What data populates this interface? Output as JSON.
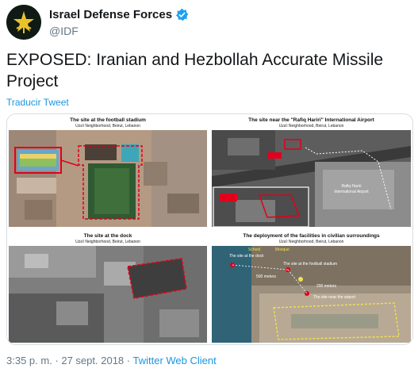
{
  "account": {
    "display_name": "Israel Defense Forces",
    "handle": "@IDF",
    "avatar_icon": "idf-emblem-icon",
    "verified_icon": "verified-badge-icon"
  },
  "tweet": {
    "text": "EXPOSED: Iranian and Hezbollah Accurate Missile Project",
    "translate_label": "Traducir Tweet",
    "timestamp": "3:35 p. m. · 27 sept. 2018",
    "separator": " · ",
    "source": "Twitter Web Client"
  },
  "media": {
    "panels": [
      {
        "title": "The site at the football stadium",
        "subtitle": "Uza'i Neighborhood, Beirut, Lebanon"
      },
      {
        "title": "The site near the \"Rafiq Hariri\" International Airport",
        "subtitle": "Uza'i Neighborhood, Beirut, Lebanon",
        "labels": [
          "Rafiq Hariri International Airport",
          "The site"
        ]
      },
      {
        "title": "The site at the dock",
        "subtitle": "Uza'i Neighborhood, Beirut, Lebanon"
      },
      {
        "title": "The deployment of the facilities in civilian surroundings",
        "subtitle": "Uza'i Neighborhood, Beirut, Lebanon",
        "labels": [
          "The site at the dock",
          "Mosque",
          "School",
          "The site at the football stadium",
          "The site near the airport",
          "500 meters",
          "200 meters"
        ]
      }
    ]
  },
  "colors": {
    "link": "#1b95e0",
    "muted": "#657786",
    "highlight": "#e0001b"
  }
}
